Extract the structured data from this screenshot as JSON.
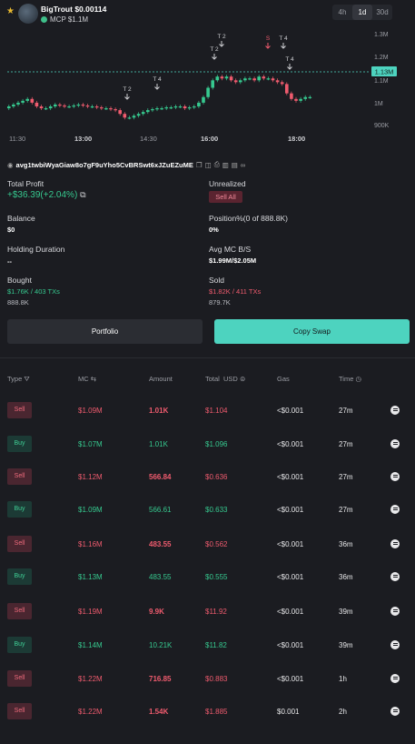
{
  "header": {
    "token_name": "BigTrout",
    "price": "$0.00114",
    "mcp": "MCP $1.1M",
    "timeframes": [
      "4h",
      "1d",
      "30d"
    ],
    "active_timeframe": "1d"
  },
  "chart_data": {
    "type": "candlestick",
    "x_ticks": [
      "11:30",
      "13:00",
      "14:30",
      "16:00",
      "18:00"
    ],
    "y_ticks": [
      "1.3M",
      "1.2M",
      "1.1M",
      "1M",
      "900K"
    ],
    "current_value": "1.13M",
    "markers": [
      "T 2",
      "T 4",
      "T 2",
      "T 2",
      "S",
      "T 4",
      "T 4"
    ],
    "colors": {
      "up": "#36c98f",
      "down": "#ef5b6e",
      "current": "#4dd3bf"
    }
  },
  "wallet": {
    "address": "avg1twbiWyaGiaw8o7gF9uYho5CvBRSwt6xJZuEZuME"
  },
  "stats": {
    "total_profit_label": "Total Profit",
    "total_profit": "+$36.39(+2.04%)",
    "unrealized_label": "Unrealized",
    "sell_all": "Sell All",
    "balance_label": "Balance",
    "balance": "$0",
    "position_label": "Position%(0 of 888.8K)",
    "position": "0%",
    "holding_label": "Holding Duration",
    "holding": "--",
    "avg_label": "Avg MC B/S",
    "avg": "$1.99M/$2.05M",
    "bought_label": "Bought",
    "bought": "$1.76K / 403 TXs",
    "bought_sub": "888.8K",
    "sold_label": "Sold",
    "sold": "$1.82K / 411 TXs",
    "sold_sub": "879.7K"
  },
  "actions": {
    "portfolio": "Portfolio",
    "copy_swap": "Copy Swap"
  },
  "table": {
    "headers": {
      "type": "Type",
      "mc": "MC",
      "amount": "Amount",
      "total": "Total",
      "usd": "USD",
      "gas": "Gas",
      "time": "Time"
    },
    "rows": [
      {
        "type": "Sell",
        "mc": "$1.09M",
        "amount": "1.01K",
        "total": "$1.104",
        "gas": "<$0.001",
        "time": "27m"
      },
      {
        "type": "Buy",
        "mc": "$1.07M",
        "amount": "1.01K",
        "total": "$1.096",
        "gas": "<$0.001",
        "time": "27m"
      },
      {
        "type": "Sell",
        "mc": "$1.12M",
        "amount": "566.84",
        "total": "$0.636",
        "gas": "<$0.001",
        "time": "27m"
      },
      {
        "type": "Buy",
        "mc": "$1.09M",
        "amount": "566.61",
        "total": "$0.633",
        "gas": "<$0.001",
        "time": "27m"
      },
      {
        "type": "Sell",
        "mc": "$1.16M",
        "amount": "483.55",
        "total": "$0.562",
        "gas": "<$0.001",
        "time": "36m"
      },
      {
        "type": "Buy",
        "mc": "$1.13M",
        "amount": "483.55",
        "total": "$0.555",
        "gas": "<$0.001",
        "time": "36m"
      },
      {
        "type": "Sell",
        "mc": "$1.19M",
        "amount": "9.9K",
        "total": "$11.92",
        "gas": "<$0.001",
        "time": "39m"
      },
      {
        "type": "Buy",
        "mc": "$1.14M",
        "amount": "10.21K",
        "total": "$11.82",
        "gas": "<$0.001",
        "time": "39m"
      },
      {
        "type": "Sell",
        "mc": "$1.22M",
        "amount": "716.85",
        "total": "$0.883",
        "gas": "<$0.001",
        "time": "1h"
      },
      {
        "type": "Sell",
        "mc": "$1.22M",
        "amount": "1.54K",
        "total": "$1.885",
        "gas": "$0.001",
        "time": "2h"
      }
    ]
  }
}
